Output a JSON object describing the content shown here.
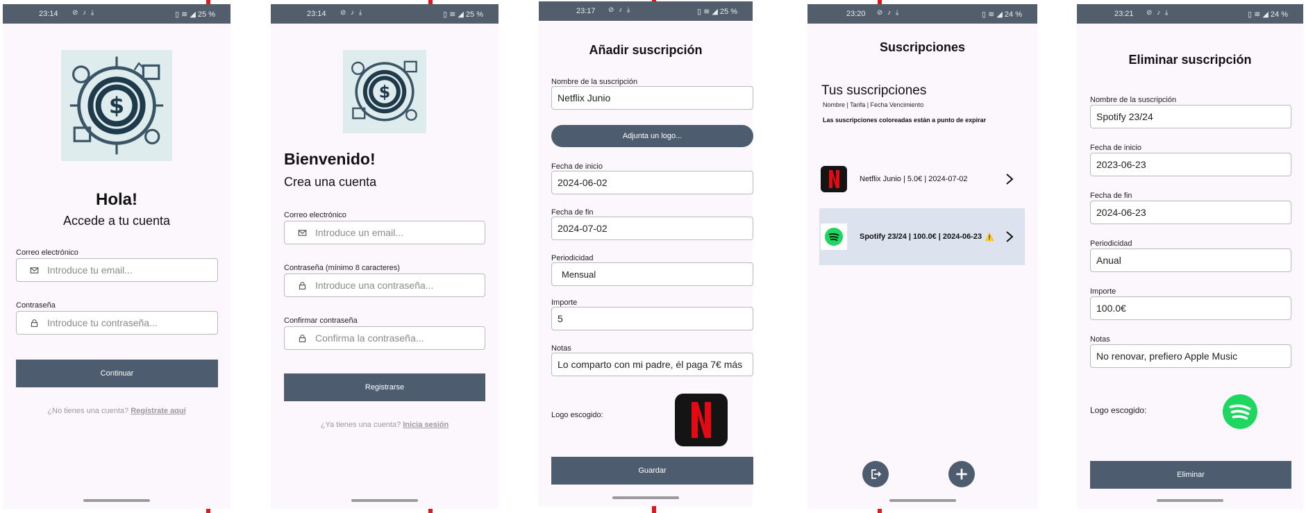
{
  "s1": {
    "status_time": "23:14",
    "status_right": "25 %",
    "greeting": "Hola!",
    "subtitle": "Accede a tu cuenta",
    "email_label": "Correo electrónico",
    "email_placeholder": "Introduce tu email...",
    "password_label": "Contraseña",
    "password_placeholder": "Introduce tu contraseña...",
    "continue_label": "Continuar",
    "no_account_text": "¿No tienes una cuenta?",
    "register_link": "Regístrate aquí"
  },
  "s2": {
    "status_time": "23:14",
    "status_right": "25 %",
    "welcome": "Bienvenido!",
    "subtitle": "Crea una cuenta",
    "email_label": "Correo electrónico",
    "email_placeholder": "Introduce un email...",
    "password_label": "Contraseña (mínimo 8 caracteres)",
    "password_placeholder": "Introduce una contraseña...",
    "confirm_label": "Confirmar contraseña",
    "confirm_placeholder": "Confirma la contraseña...",
    "register_button": "Registrarse",
    "have_account_text": "¿Ya tienes una cuenta?",
    "login_link": "Inicia sesión"
  },
  "s3": {
    "status_time": "23:17",
    "status_right": "25 %",
    "title": "Añadir suscripción",
    "name_label": "Nombre de la suscripción",
    "name_value": "Netflix Junio",
    "attach_logo": "Adjunta un logo...",
    "start_label": "Fecha de inicio",
    "start_value": "2024-06-02",
    "end_label": "Fecha de fin",
    "end_value": "2024-07-02",
    "period_label": "Periodicidad",
    "period_value": "Mensual",
    "amount_label": "Importe",
    "amount_value": "5",
    "notes_label": "Notas",
    "notes_value": "Lo comparto con mi padre, él paga 7€ más",
    "logo_chosen_label": "Logo escogido:",
    "save_button": "Guardar"
  },
  "s4": {
    "status_time": "23:20",
    "status_right": "24 %",
    "title": "Suscripciones",
    "heading": "Tus suscripciones",
    "columns": "Nombre | Tarifa | Fecha Vencimiento",
    "note": "Las suscripciones coloreadas están a punto de expirar",
    "items": [
      {
        "text": "Netflix Junio | 5.0€ | 2024-07-02",
        "highlight": false,
        "warning": ""
      },
      {
        "text": "Spotify 23/24 | 100.0€ | 2024-06-23",
        "highlight": true,
        "warning": "⚠️"
      }
    ],
    "logout_icon": "logout-icon",
    "add_icon": "add-circle-icon"
  },
  "s5": {
    "status_time": "23:21",
    "status_right": "24 %",
    "title": "Eliminar suscripción",
    "name_label": "Nombre de la suscripción",
    "name_value": "Spotify 23/24",
    "start_label": "Fecha de inicio",
    "start_value": "2023-06-23",
    "end_label": "Fecha de fin",
    "end_value": "2024-06-23",
    "period_label": "Periodicidad",
    "period_value": "Anual",
    "amount_label": "Importe",
    "amount_value": "100.0€",
    "notes_label": "Notas",
    "notes_value": "No renovar, prefiero Apple Music",
    "logo_chosen_label": "Logo escogido:",
    "delete_button": "Eliminar"
  },
  "colors": {
    "divider": "#e8141b",
    "statusbar": "#525e6b",
    "background": "#fcf7fd",
    "button": "#4d5d6f",
    "highlight_row": "#dce3ee",
    "netflix_red": "#e50914",
    "spotify_green": "#1ed760"
  }
}
